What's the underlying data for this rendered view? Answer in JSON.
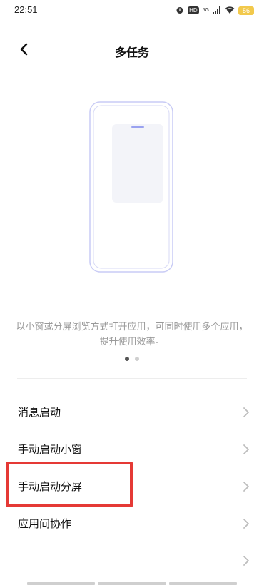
{
  "status_bar": {
    "time": "22:51",
    "hd_label": "HD",
    "network_label": "5G",
    "battery_level": "56",
    "battery_color": "#f2c94c"
  },
  "header": {
    "title": "多任务"
  },
  "intro": {
    "description": "以小窗或分屏浏览方式打开应用，可同时使用多个应用，提升使用效率。",
    "page_count": 2,
    "active_page": 1
  },
  "menu": {
    "items": [
      {
        "label": "消息启动"
      },
      {
        "label": "手动启动小窗"
      },
      {
        "label": "手动启动分屏"
      },
      {
        "label": ""
      }
    ]
  },
  "extra_item_label": "应用间协作",
  "colors": {
    "accent_outline": "#c9ccf5",
    "highlight": "#e53935",
    "secondary_text": "#9a9a9a"
  }
}
